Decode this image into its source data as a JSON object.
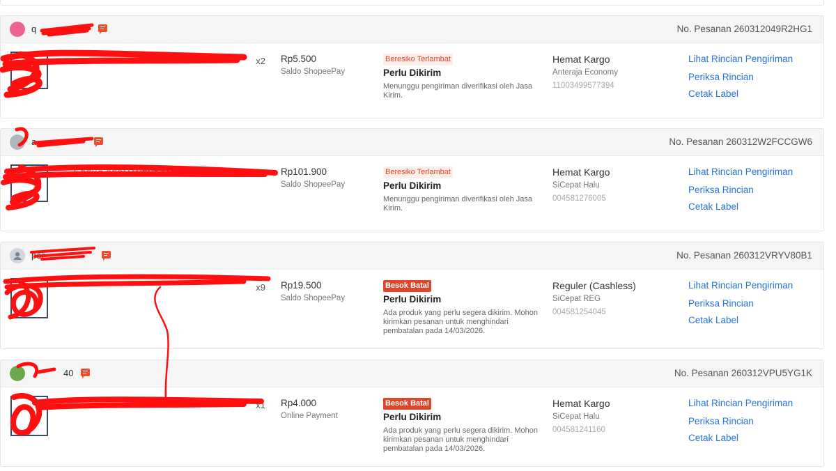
{
  "orders": [
    {
      "buyer": {
        "name": "q",
        "avatar_color": "#f06292",
        "avatar_icon": "shop-avatar-icon"
      },
      "order_no": "No. Pesanan 260312049R2HG1",
      "product": {
        "name": "",
        "qty": "x2"
      },
      "price": "Rp5.500",
      "payment": "Saldo ShopeePay",
      "badge": {
        "label": "Beresiko Terlambat",
        "kind": "risk"
      },
      "status": "Perlu Dikirim",
      "status_desc": "Menunggu pengiriman diverifikasi oleh Jasa Kirim.",
      "courier": {
        "type": "Hemat Kargo",
        "service": "Anteraja Economy",
        "tracking": "11003499577394"
      },
      "actions": [
        "Lihat Rincian Pengiriman",
        "Periksa Rincian",
        "Cetak Label"
      ]
    },
    {
      "buyer": {
        "name": "a",
        "avatar_color": "#b0b6be",
        "avatar_icon": "user-avatar-icon"
      },
      "order_no": "No. Pesanan 260312W2FCCGW6",
      "product": {
        "name": "L BEKO PERMANENT TANI",
        "qty": ""
      },
      "price": "Rp101.900",
      "payment": "Saldo ShopeePay",
      "badge": {
        "label": "Beresiko Terlambat",
        "kind": "risk"
      },
      "status": "Perlu Dikirim",
      "status_desc": "Menunggu pengiriman diverifikasi oleh Jasa Kirim.",
      "courier": {
        "type": "Hemat Kargo",
        "service": "SiCepat Halu",
        "tracking": "004581276005"
      },
      "actions": [
        "Lihat Rincian Pengiriman",
        "Periksa Rincian",
        "Cetak Label"
      ]
    },
    {
      "buyer": {
        "name": "per",
        "avatar_color": "#c9d1d9",
        "avatar_icon": "user-avatar-icon"
      },
      "order_no": "No. Pesanan 260312VRYV80B1",
      "product": {
        "name": "",
        "qty": "x9"
      },
      "price": "Rp19.500",
      "payment": "Saldo ShopeePay",
      "badge": {
        "label": "Besok Batal",
        "kind": "cancel"
      },
      "status": "Perlu Dikirim",
      "status_desc": "Ada produk yang perlu segera dikirim. Mohon kirimkan pesanan untuk menghindari pembatalan pada 14/03/2026.",
      "courier": {
        "type": "Reguler (Cashless)",
        "service": "SiCepat REG",
        "tracking": "004581254045"
      },
      "actions": [
        "Lihat Rincian Pengiriman",
        "Periksa Rincian",
        "Cetak Label"
      ]
    },
    {
      "buyer": {
        "name": "40",
        "avatar_color": "#6aa84f",
        "avatar_icon": "user-avatar-icon"
      },
      "order_no": "No. Pesanan 260312VPU5YG1K",
      "product": {
        "name": "",
        "qty": "x1"
      },
      "price": "Rp4.000",
      "payment": "Online Payment",
      "badge": {
        "label": "Besok Batal",
        "kind": "cancel"
      },
      "status": "Perlu Dikirim",
      "status_desc": "Ada produk yang perlu segera dikirim. Mohon kirimkan pesanan untuk menghindari pembatalan pada 14/03/2026.",
      "courier": {
        "type": "Hemat Kargo",
        "service": "SiCepat Halu",
        "tracking": "004581241160"
      },
      "actions": [
        "Lihat Rincian Pengiriman",
        "Periksa Rincian",
        "Cetak Label"
      ]
    }
  ]
}
